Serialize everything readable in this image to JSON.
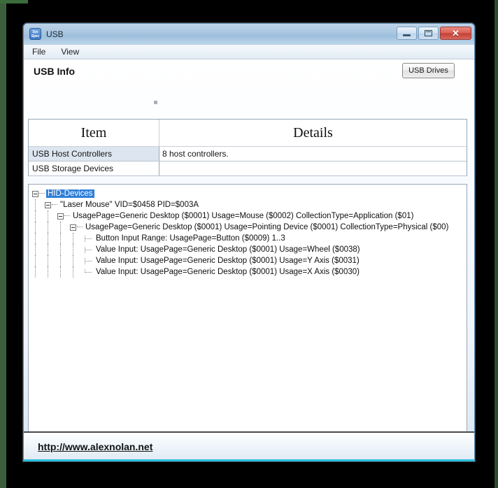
{
  "window": {
    "title": "USB",
    "icon_name": "sys-spec-icon",
    "icon_line1": "Sys",
    "icon_line2": "Spec",
    "minimize_label": "",
    "maximize_label": "",
    "close_label": "✕"
  },
  "menu": {
    "items": [
      {
        "label": "File"
      },
      {
        "label": "View"
      }
    ]
  },
  "header": {
    "title": "USB Info",
    "usb_drives_button": "USB Drives"
  },
  "table": {
    "columns": [
      "Item",
      "Details"
    ],
    "rows": [
      {
        "item": "USB Host Controllers",
        "details": "8 host controllers."
      },
      {
        "item": "USB Storage Devices",
        "details": ""
      }
    ]
  },
  "tree": {
    "selected": "HID-Devices",
    "nodes": [
      {
        "label": "HID-Devices",
        "depth": 0,
        "type": "expanded",
        "selected": true
      },
      {
        "label": "\"Laser Mouse\"  VID=$0458 PID=$003A",
        "depth": 1,
        "type": "expanded",
        "selected": false
      },
      {
        "label": "UsagePage=Generic Desktop ($0001)  Usage=Mouse ($0002)  CollectionType=Application ($01)",
        "depth": 2,
        "type": "expanded",
        "selected": false
      },
      {
        "label": "UsagePage=Generic Desktop ($0001)  Usage=Pointing Device ($0001)  CollectionType=Physical ($00)",
        "depth": 3,
        "type": "expanded",
        "selected": false
      },
      {
        "label": "Button Input Range: UsagePage=Button ($0009) 1..3",
        "depth": 4,
        "type": "leaf",
        "selected": false
      },
      {
        "label": "Value Input: UsagePage=Generic Desktop ($0001) Usage=Wheel ($0038)",
        "depth": 4,
        "type": "leaf",
        "selected": false
      },
      {
        "label": "Value Input: UsagePage=Generic Desktop ($0001) Usage=Y Axis ($0031)",
        "depth": 4,
        "type": "leaf",
        "selected": false
      },
      {
        "label": "Value Input: UsagePage=Generic Desktop ($0001) Usage=X Axis ($0030)",
        "depth": 4,
        "type": "leaf-last",
        "selected": false
      }
    ]
  },
  "footer": {
    "link_text": "http://www.alexnolan.net"
  },
  "colors": {
    "selection_blue": "#2f7fd8",
    "titlebar_blue": "#a9c6e0",
    "window_border": "#5a8ab5",
    "bottom_accent": "#28c0dc",
    "row_highlight": "#dde6f0",
    "desktop": "#000000",
    "edge_green": "#3c5e3c"
  }
}
